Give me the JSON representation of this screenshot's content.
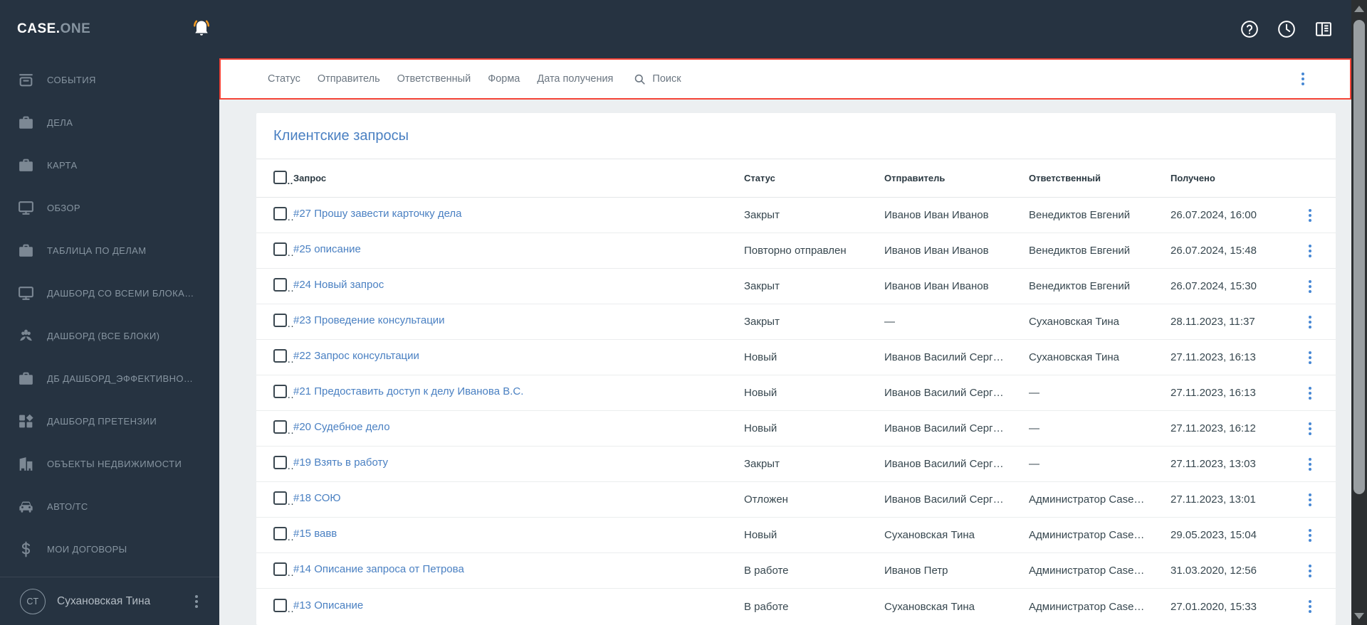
{
  "brand": {
    "primary": "CASE.",
    "secondary": "ONE"
  },
  "header": {
    "title": "Клиентские запросы",
    "bell_icon": "notification-bell",
    "right_icons": [
      "help-icon",
      "history-clock-icon",
      "layout-panel-icon"
    ]
  },
  "sidebar": {
    "items": [
      {
        "icon": "archive-icon",
        "label": "СОБЫТИЯ"
      },
      {
        "icon": "briefcase-icon",
        "label": "ДЕЛА"
      },
      {
        "icon": "briefcase-icon",
        "label": "КАРТА"
      },
      {
        "icon": "monitor-icon",
        "label": "ОБЗОР"
      },
      {
        "icon": "briefcase-icon",
        "label": "ТАБЛИЦА ПО ДЕЛАМ"
      },
      {
        "icon": "monitor-icon",
        "label": "ДАШБОРД СО ВСЕМИ БЛОКА…"
      },
      {
        "icon": "flower-icon",
        "label": "ДАШБОРД (ВСЕ БЛОКИ)"
      },
      {
        "icon": "briefcase-icon",
        "label": "ДБ ДАШБОРД_ЭФФЕКТИВНО…"
      },
      {
        "icon": "dashboard-icon",
        "label": "ДАШБОРД ПРЕТЕНЗИИ"
      },
      {
        "icon": "building-icon",
        "label": "ОБЪЕКТЫ НЕДВИЖИМОСТИ"
      },
      {
        "icon": "car-icon",
        "label": "АВТО/ТС"
      },
      {
        "icon": "dollar-icon",
        "label": "МОИ ДОГОВОРЫ"
      }
    ],
    "user": {
      "initials": "СТ",
      "name": "Сухановская Тина"
    }
  },
  "filter_bar": {
    "filters": [
      "Статус",
      "Отправитель",
      "Ответственный",
      "Форма",
      "Дата получения"
    ],
    "search_label": "Поиск"
  },
  "content": {
    "section_title": "Клиентские запросы",
    "table": {
      "columns": [
        "Запрос",
        "Статус",
        "Отправитель",
        "Ответственный",
        "Получено"
      ],
      "rows": [
        {
          "request": "#27 Прошу завести карточку дела",
          "status": "Закрыт",
          "sender": "Иванов Иван Иванов",
          "responsible": "Венедиктов Евгений",
          "received": "26.07.2024, 16:00"
        },
        {
          "request": "#25 описание",
          "status": "Повторно отправлен",
          "sender": "Иванов Иван Иванов",
          "responsible": "Венедиктов Евгений",
          "received": "26.07.2024, 15:48"
        },
        {
          "request": "#24 Новый запрос",
          "status": "Закрыт",
          "sender": "Иванов Иван Иванов",
          "responsible": "Венедиктов Евгений",
          "received": "26.07.2024, 15:30"
        },
        {
          "request": "#23 Проведение консультации",
          "status": "Закрыт",
          "sender": "—",
          "responsible": "Сухановская Тина",
          "received": "28.11.2023, 11:37"
        },
        {
          "request": "#22 Запрос консультации",
          "status": "Новый",
          "sender": "Иванов Василий Серг…",
          "responsible": "Сухановская Тина",
          "received": "27.11.2023, 16:13"
        },
        {
          "request": "#21 Предоставить доступ к делу Иванова В.С.",
          "status": "Новый",
          "sender": "Иванов Василий Серг…",
          "responsible": "—",
          "received": "27.11.2023, 16:13"
        },
        {
          "request": "#20 Судебное дело",
          "status": "Новый",
          "sender": "Иванов Василий Серг…",
          "responsible": "—",
          "received": "27.11.2023, 16:12"
        },
        {
          "request": "#19 Взять в работу",
          "status": "Закрыт",
          "sender": "Иванов Василий Серг…",
          "responsible": "—",
          "received": "27.11.2023, 13:03"
        },
        {
          "request": "#18 СОЮ",
          "status": "Отложен",
          "sender": "Иванов Василий Серг…",
          "responsible": "Администратор Case…",
          "received": "27.11.2023, 13:01"
        },
        {
          "request": "#15 вавв",
          "status": "Новый",
          "sender": "Сухановская Тина",
          "responsible": "Администратор Case…",
          "received": "29.05.2023, 15:04"
        },
        {
          "request": "#14 Описание запроса от Петрова",
          "status": "В работе",
          "sender": "Иванов Петр",
          "responsible": "Администратор Case…",
          "received": "31.03.2020, 12:56"
        },
        {
          "request": "#13 Описание",
          "status": "В работе",
          "sender": "Сухановская Тина",
          "responsible": "Администратор Case…",
          "received": "27.01.2020, 15:33"
        }
      ]
    }
  },
  "colors": {
    "chrome_bg": "#263341",
    "content_bg": "#eceff1",
    "highlight_red": "#f44336",
    "link_blue": "#4a80c2",
    "row_menu_blue": "#4788d4",
    "bell_orange": "#f59b22",
    "sidebar_text": "#8795a1"
  }
}
